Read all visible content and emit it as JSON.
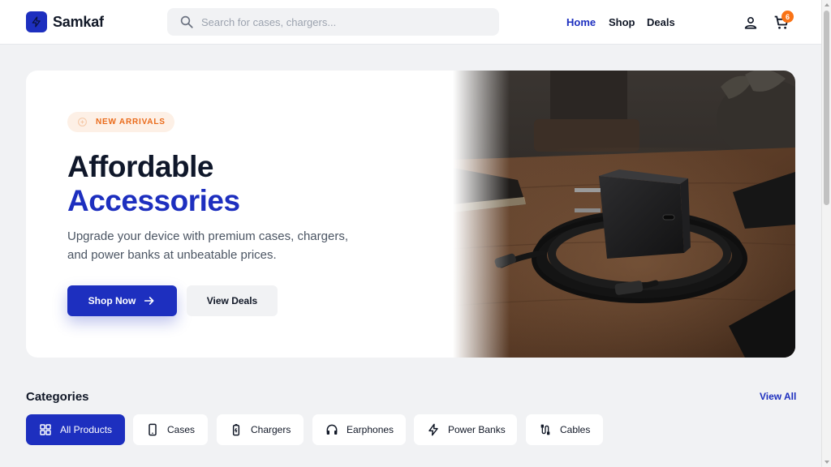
{
  "brand": {
    "name": "Samkaf",
    "color": "#1d2fbf"
  },
  "search": {
    "placeholder": "Search for cases, chargers..."
  },
  "nav": {
    "home": "Home",
    "shop": "Shop",
    "deals": "Deals",
    "active": "Home"
  },
  "header": {
    "account_icon": "user-icon",
    "cart_icon": "cart-icon",
    "cart_count": "6",
    "badge_color": "#f97316"
  },
  "hero": {
    "badge": "NEW ARRIVALS",
    "title_line1": "Affordable",
    "title_line2": "Accessories",
    "description": "Upgrade your device with premium cases, chargers, and power banks at unbeatable prices.",
    "primary_button": "Shop Now",
    "secondary_button": "View Deals",
    "accent_color": "#ea6a1a"
  },
  "categories": {
    "title": "Categories",
    "view_all": "View All",
    "items": [
      {
        "label": "All Products",
        "icon": "grid-icon",
        "active": true
      },
      {
        "label": "Cases",
        "icon": "phone-case-icon",
        "active": false
      },
      {
        "label": "Chargers",
        "icon": "charger-icon",
        "active": false
      },
      {
        "label": "Earphones",
        "icon": "headphones-icon",
        "active": false
      },
      {
        "label": "Power Banks",
        "icon": "bolt-icon",
        "active": false
      },
      {
        "label": "Cables",
        "icon": "cable-icon",
        "active": false
      }
    ]
  }
}
